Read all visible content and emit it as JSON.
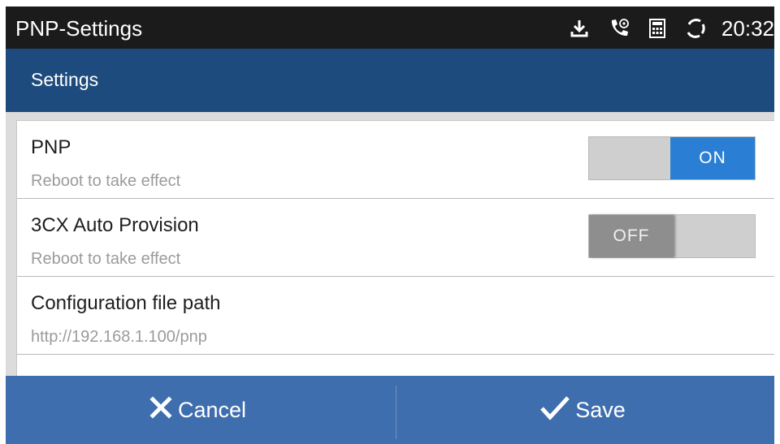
{
  "status_bar": {
    "title": "PNP-Settings",
    "time": "20:32",
    "icons": [
      "download-icon",
      "phone-call-icon",
      "calculator-icon",
      "sync-icon"
    ]
  },
  "app_bar": {
    "title": "Settings"
  },
  "settings": [
    {
      "title": "PNP",
      "subtitle": "Reboot to take effect",
      "toggle": "ON"
    },
    {
      "title": "3CX Auto Provision",
      "subtitle": "Reboot to take effect",
      "toggle": "OFF"
    },
    {
      "title": "Configuration file path",
      "subtitle": "http://192.168.1.100/pnp"
    }
  ],
  "actions": {
    "cancel": "Cancel",
    "save": "Save"
  },
  "colors": {
    "status_bar": "#1b1b1b",
    "app_bar": "#1e4b7d",
    "bottom_bar": "#3f6eae",
    "toggle_on": "#2a7fd4",
    "toggle_off": "#8e8e8e"
  }
}
